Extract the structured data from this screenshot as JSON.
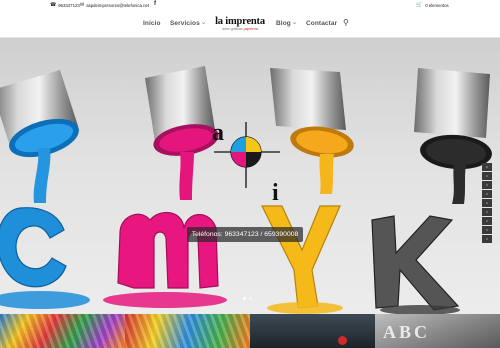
{
  "topbar": {
    "phone": "963347123",
    "email": "aspdeimpresores@telefonica.net",
    "cart": "0 elementos",
    "icons": [
      "phone-icon",
      "mail-icon",
      "facebook-icon",
      "cart-icon"
    ]
  },
  "nav": {
    "items": [
      {
        "label": "Inicio"
      },
      {
        "label": "Servicios",
        "dropdown": true
      },
      {
        "label": "Blog",
        "dropdown": true
      },
      {
        "label": "Contactar"
      }
    ],
    "logo": {
      "title": "la imprenta",
      "subtitle_prefix": "artes gráficas",
      "subtitle_highlight": "papelería"
    }
  },
  "hero": {
    "caption": "Teléfonos: 963347123 / 659390008",
    "letters": [
      "C",
      "M",
      "Y",
      "K"
    ],
    "logo_letters": [
      "a",
      "i"
    ],
    "colors": {
      "cyan": "#1e8ed8",
      "magenta": "#e5157e",
      "yellow": "#f4b61a",
      "black": "#3c3c3c"
    },
    "slides": 2,
    "active_slide": 1
  },
  "thumbnails": [
    "colored-pencils-thumbnail",
    "stationery-thumbnail",
    "chalkboard-thumbnail",
    "letterpress-thumbnail"
  ],
  "thumb_letters": "ABC"
}
